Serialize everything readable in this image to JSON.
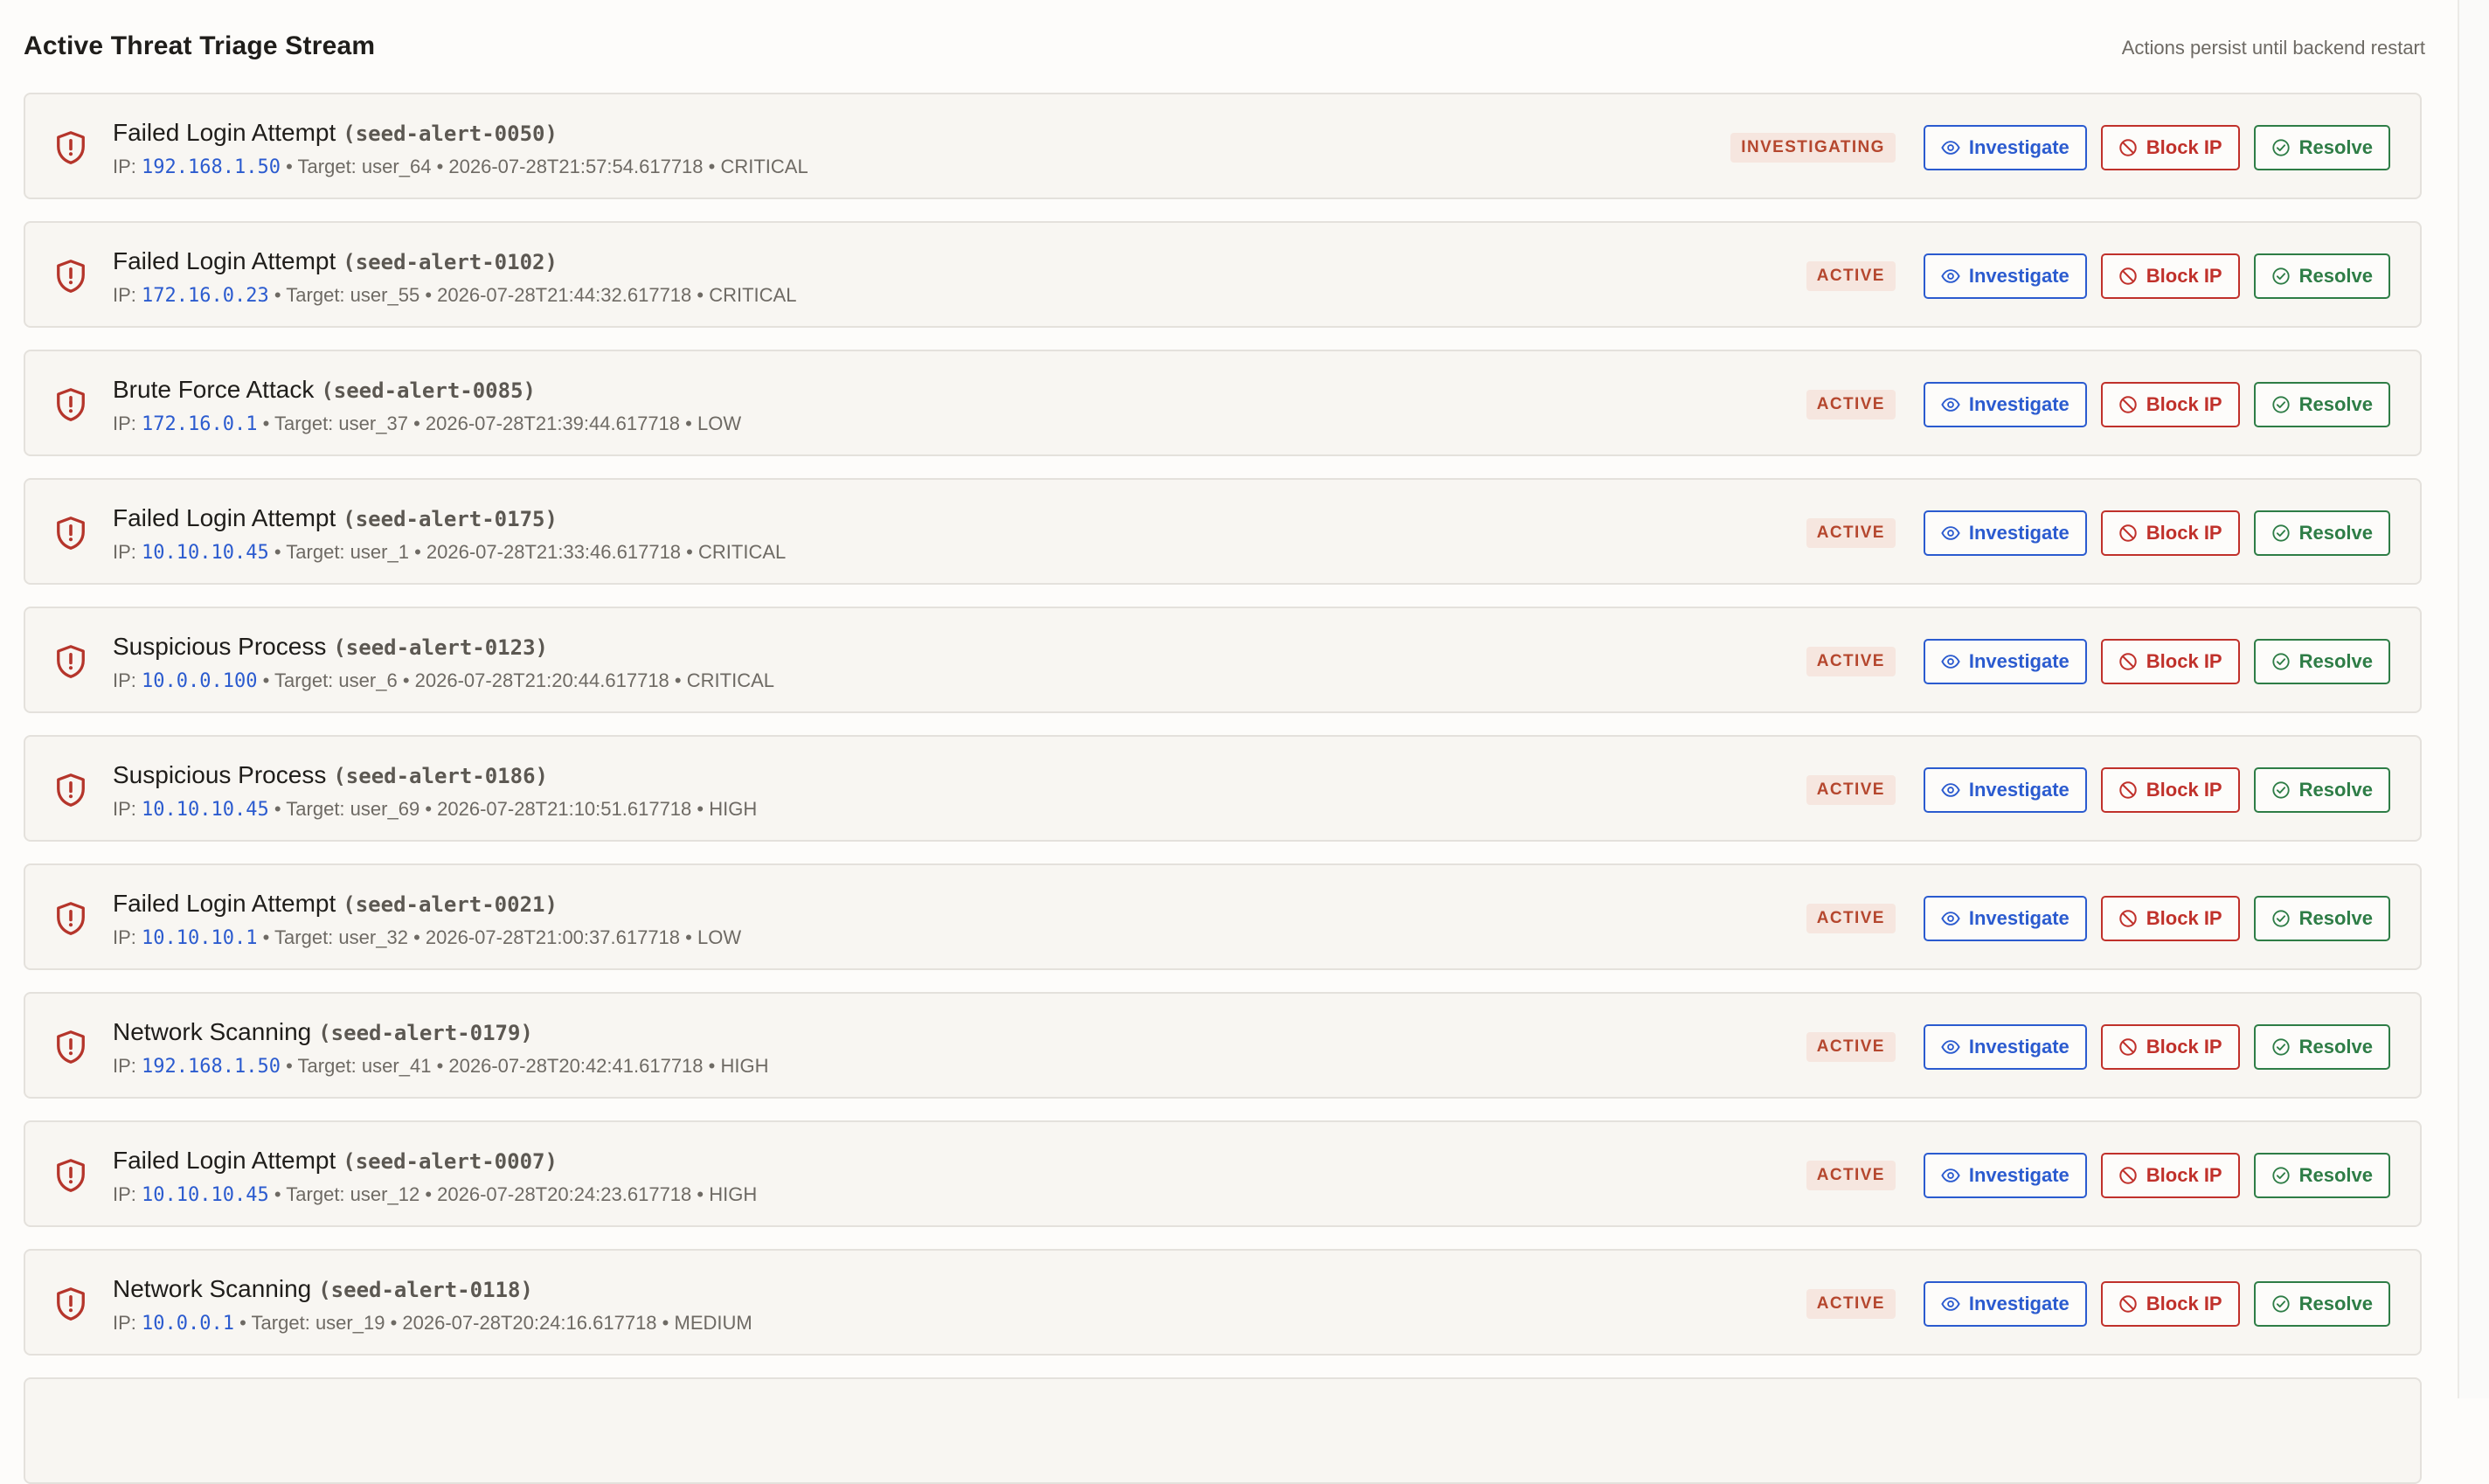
{
  "header": {
    "title": "Active Threat Triage Stream",
    "note": "Actions persist until backend restart"
  },
  "labels": {
    "ip_prefix": "IP:",
    "target_prefix": "Target:",
    "separator": "•",
    "investigate": "Investigate",
    "block_ip": "Block IP",
    "resolve": "Resolve"
  },
  "colors": {
    "investigate": "#2b5bcf",
    "block": "#c0312b",
    "resolve": "#2e7d46",
    "status": "#b5472e",
    "shield": "#b5352b"
  },
  "alerts": [
    {
      "title": "Failed Login Attempt",
      "id": "(seed-alert-0050)",
      "ip": "192.168.1.50",
      "target": "user_64",
      "timestamp": "2026-07-28T21:57:54.617718",
      "severity": "CRITICAL",
      "status": "INVESTIGATING"
    },
    {
      "title": "Failed Login Attempt",
      "id": "(seed-alert-0102)",
      "ip": "172.16.0.23",
      "target": "user_55",
      "timestamp": "2026-07-28T21:44:32.617718",
      "severity": "CRITICAL",
      "status": "ACTIVE"
    },
    {
      "title": "Brute Force Attack",
      "id": "(seed-alert-0085)",
      "ip": "172.16.0.1",
      "target": "user_37",
      "timestamp": "2026-07-28T21:39:44.617718",
      "severity": "LOW",
      "status": "ACTIVE"
    },
    {
      "title": "Failed Login Attempt",
      "id": "(seed-alert-0175)",
      "ip": "10.10.10.45",
      "target": "user_1",
      "timestamp": "2026-07-28T21:33:46.617718",
      "severity": "CRITICAL",
      "status": "ACTIVE"
    },
    {
      "title": "Suspicious Process",
      "id": "(seed-alert-0123)",
      "ip": "10.0.0.100",
      "target": "user_6",
      "timestamp": "2026-07-28T21:20:44.617718",
      "severity": "CRITICAL",
      "status": "ACTIVE"
    },
    {
      "title": "Suspicious Process",
      "id": "(seed-alert-0186)",
      "ip": "10.10.10.45",
      "target": "user_69",
      "timestamp": "2026-07-28T21:10:51.617718",
      "severity": "HIGH",
      "status": "ACTIVE"
    },
    {
      "title": "Failed Login Attempt",
      "id": "(seed-alert-0021)",
      "ip": "10.10.10.1",
      "target": "user_32",
      "timestamp": "2026-07-28T21:00:37.617718",
      "severity": "LOW",
      "status": "ACTIVE"
    },
    {
      "title": "Network Scanning",
      "id": "(seed-alert-0179)",
      "ip": "192.168.1.50",
      "target": "user_41",
      "timestamp": "2026-07-28T20:42:41.617718",
      "severity": "HIGH",
      "status": "ACTIVE"
    },
    {
      "title": "Failed Login Attempt",
      "id": "(seed-alert-0007)",
      "ip": "10.10.10.45",
      "target": "user_12",
      "timestamp": "2026-07-28T20:24:23.617718",
      "severity": "HIGH",
      "status": "ACTIVE"
    },
    {
      "title": "Network Scanning",
      "id": "(seed-alert-0118)",
      "ip": "10.0.0.1",
      "target": "user_19",
      "timestamp": "2026-07-28T20:24:16.617718",
      "severity": "MEDIUM",
      "status": "ACTIVE"
    }
  ]
}
